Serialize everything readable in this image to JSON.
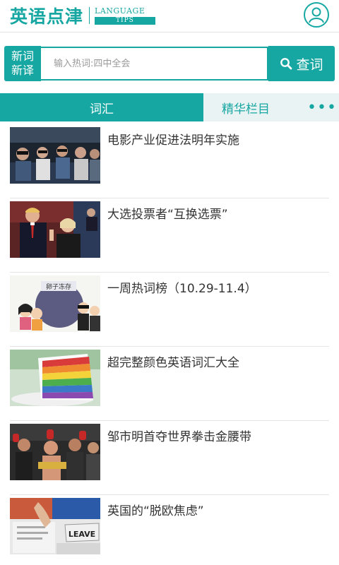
{
  "header": {
    "logo_cn": "英语点津",
    "logo_en_line1": "LANGUAGE",
    "logo_en_line2": "TIPS",
    "profile_icon": "user-profile-icon"
  },
  "search": {
    "newword_line1": "新词",
    "newword_line2": "新译",
    "placeholder": "输入热词:四中全会",
    "value": "",
    "button_label": "查词",
    "button_icon": "search-icon"
  },
  "tabs": [
    {
      "label": "词汇",
      "active": true
    },
    {
      "label": "精华栏目",
      "active": false
    },
    {
      "label": "•••",
      "icon": "more-icon"
    }
  ],
  "articles": [
    {
      "title": "电影产业促进法明年实施",
      "thumb": "cinema-audience-image"
    },
    {
      "title": "大选投票者“互换选票”",
      "thumb": "election-debate-image"
    },
    {
      "title": "一周热词榜（10.29-11.4）",
      "thumb": "cartoon-illustration-image"
    },
    {
      "title": "超完整颜色英语词汇大全",
      "thumb": "rainbow-cake-image"
    },
    {
      "title": "邹市明首夺世界拳击金腰带",
      "thumb": "boxing-champion-image"
    },
    {
      "title": "英国的“脱欧焦虑”",
      "thumb": "leave-ballot-image"
    }
  ],
  "thumb_texts": {
    "cartoon_sign": "卵子冻存",
    "leave_sign": "LEAVE"
  },
  "colors": {
    "accent": "#17a7a2",
    "tab_bg": "#eaf3f3"
  }
}
